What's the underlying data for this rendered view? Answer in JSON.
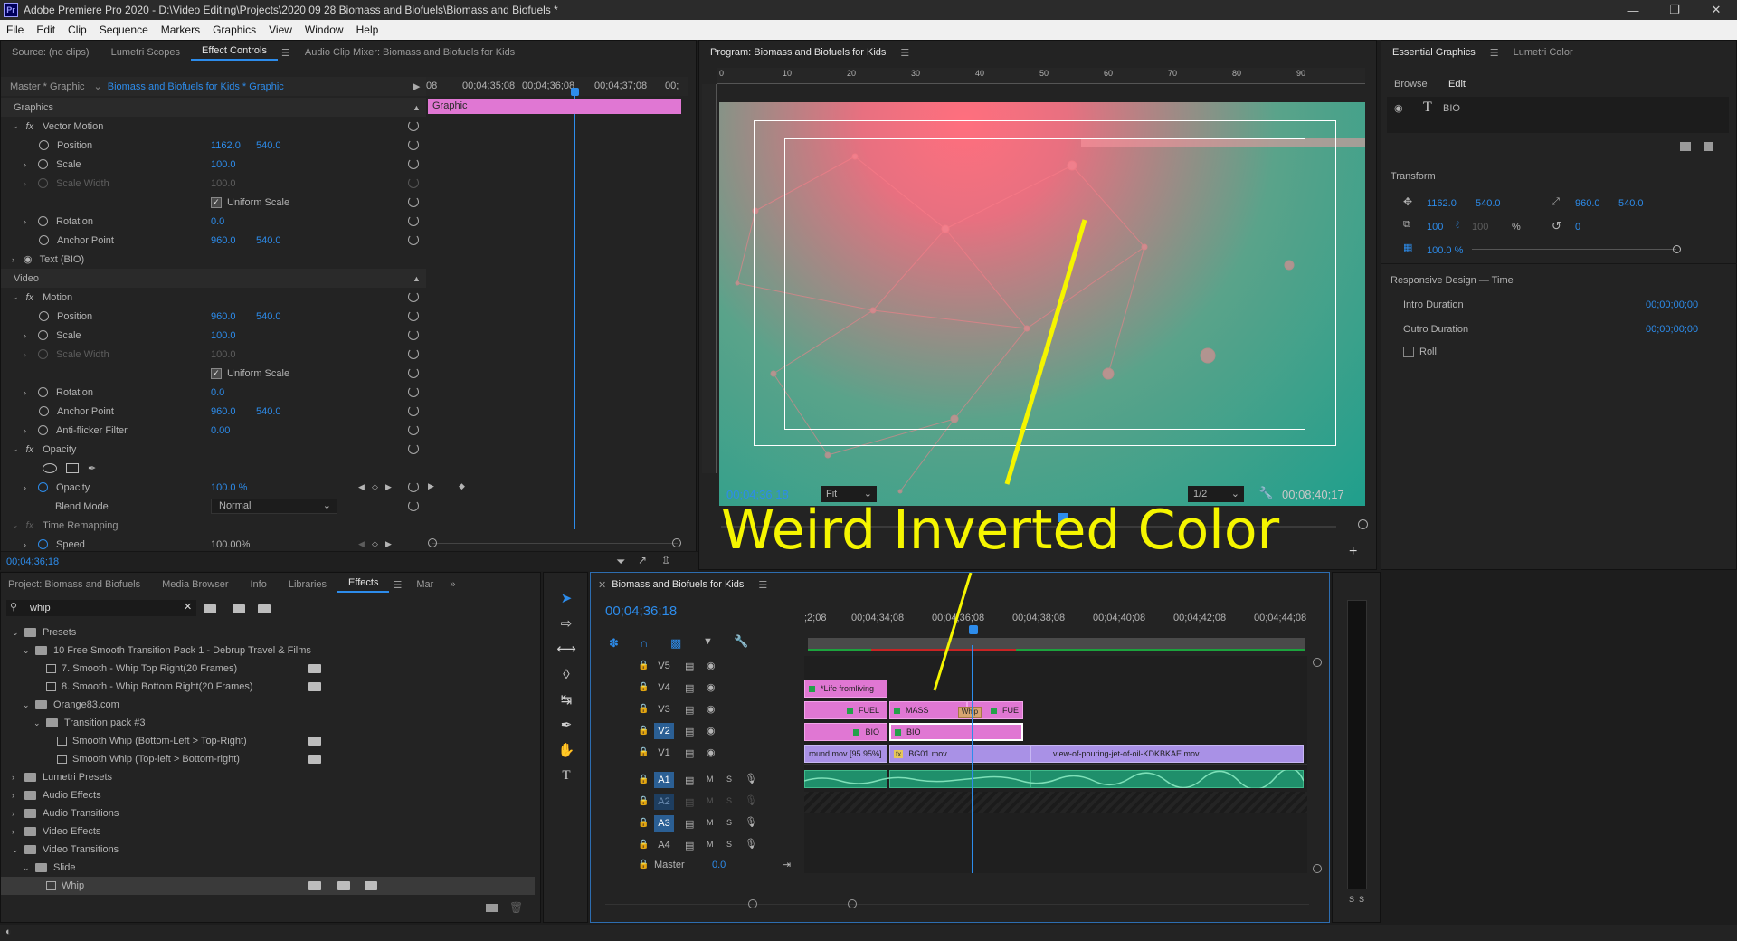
{
  "app": {
    "window_title": "Adobe Premiere Pro 2020 - D:\\Video Editing\\Projects\\2020 09 28 Biomass and Biofuels\\Biomass and Biofuels *",
    "logo": "Pr",
    "menu": [
      "File",
      "Edit",
      "Clip",
      "Sequence",
      "Markers",
      "Graphics",
      "View",
      "Window",
      "Help"
    ]
  },
  "effect_controls": {
    "tabs": [
      "Source: (no clips)",
      "Lumetri Scopes",
      "Effect Controls",
      "Audio Clip Mixer: Biomass and Biofuels for Kids"
    ],
    "active_tab": "Effect Controls",
    "master_label": "Master * Graphic",
    "sequence_label": "Biomass and Biofuels for Kids * Graphic",
    "ruler": [
      "00;04;35;08",
      "00;04;36;08",
      "00;04;37;08",
      "00;"
    ],
    "ruler_left": "08",
    "clip_bar": "Graphic",
    "graphics_header": "Graphics",
    "vector_motion": "Vector Motion",
    "vm_position": {
      "label": "Position",
      "x": "1162.0",
      "y": "540.0"
    },
    "vm_scale": {
      "label": "Scale",
      "value": "100.0"
    },
    "vm_scale_width": {
      "label": "Scale Width",
      "value": "100.0"
    },
    "uniform_scale": "Uniform Scale",
    "vm_rotation": {
      "label": "Rotation",
      "value": "0.0"
    },
    "vm_anchor": {
      "label": "Anchor Point",
      "x": "960.0",
      "y": "540.0"
    },
    "text_layer": "Text (BIO)",
    "video_header": "Video",
    "motion": "Motion",
    "m_position": {
      "label": "Position",
      "x": "960.0",
      "y": "540.0"
    },
    "m_scale": {
      "label": "Scale",
      "value": "100.0"
    },
    "m_scale_width": {
      "label": "Scale Width",
      "value": "100.0"
    },
    "m_rotation": {
      "label": "Rotation",
      "value": "0.0"
    },
    "m_anchor": {
      "label": "Anchor Point",
      "x": "960.0",
      "y": "540.0"
    },
    "anti_flicker": {
      "label": "Anti-flicker Filter",
      "value": "0.00"
    },
    "opacity_section": "Opacity",
    "opacity": {
      "label": "Opacity",
      "value": "100.0 %"
    },
    "blend_mode": {
      "label": "Blend Mode",
      "value": "Normal"
    },
    "time_remapping": "Time Remapping",
    "speed": {
      "label": "Speed",
      "value": "100.00%"
    },
    "timecode": "00;04;36;18"
  },
  "program": {
    "tab": "Program: Biomass and Biofuels for Kids",
    "ruler": [
      "0",
      "10",
      "20",
      "30",
      "40",
      "50",
      "60",
      "70",
      "80",
      "90"
    ],
    "timecode": "00;04;36;18",
    "fit": "Fit",
    "resolution": "1/2",
    "duration": "00;08;40;17",
    "annotation": "Weird Inverted Color",
    "annotation_color": "#f5f500"
  },
  "essential_graphics": {
    "tabs": [
      "Essential Graphics",
      "Lumetri Color"
    ],
    "subtabs": [
      "Browse",
      "Edit"
    ],
    "layer": "BIO",
    "transform_label": "Transform",
    "pos_x": "1162.0",
    "pos_y": "540.0",
    "anchor_x": "960.0",
    "anchor_y": "540.0",
    "scale": "100",
    "scale2": "100",
    "pct": "%",
    "rotation": "0",
    "opacity": "100.0 %",
    "responsive": "Responsive Design — Time",
    "intro_label": "Intro Duration",
    "intro_value": "00;00;00;00",
    "outro_label": "Outro Duration",
    "outro_value": "00;00;00;00",
    "roll": "Roll"
  },
  "project": {
    "tabs": [
      "Project: Biomass and Biofuels",
      "Media Browser",
      "Info",
      "Libraries",
      "Effects",
      "Mar"
    ],
    "active_tab": "Effects",
    "search": "whip",
    "tree": [
      {
        "indent": 0,
        "type": "folder",
        "label": "Presets"
      },
      {
        "indent": 1,
        "type": "folder",
        "label": "10 Free Smooth Transition Pack 1 - Debrup Travel & Films"
      },
      {
        "indent": 2,
        "type": "preset",
        "label": "7. Smooth - Whip Top Right(20 Frames)"
      },
      {
        "indent": 2,
        "type": "preset",
        "label": "8. Smooth - Whip Bottom Right(20 Frames)"
      },
      {
        "indent": 1,
        "type": "folder",
        "label": "Orange83.com"
      },
      {
        "indent": 2,
        "type": "folder",
        "label": "Transition pack #3"
      },
      {
        "indent": 3,
        "type": "preset",
        "label": "Smooth Whip (Bottom-Left > Top-Right)"
      },
      {
        "indent": 3,
        "type": "preset",
        "label": "Smooth Whip (Top-left > Bottom-right)"
      },
      {
        "indent": 0,
        "type": "folder",
        "label": "Lumetri Presets"
      },
      {
        "indent": 0,
        "type": "folder",
        "label": "Audio Effects"
      },
      {
        "indent": 0,
        "type": "folder",
        "label": "Audio Transitions"
      },
      {
        "indent": 0,
        "type": "folder",
        "label": "Video Effects"
      },
      {
        "indent": 0,
        "type": "folder",
        "label": "Video Transitions"
      },
      {
        "indent": 1,
        "type": "folder",
        "label": "Slide"
      },
      {
        "indent": 2,
        "type": "transition",
        "label": "Whip"
      }
    ]
  },
  "timeline": {
    "tab": "Biomass and Biofuels for Kids",
    "timecode": "00;04;36;18",
    "ruler": [
      ";2;08",
      "00;04;34;08",
      "00;04;36;08",
      "00;04;38;08",
      "00;04;40;08",
      "00;04;42;08",
      "00;04;44;08"
    ],
    "video_tracks": [
      "V5",
      "V4",
      "V3",
      "V2",
      "V1"
    ],
    "audio_tracks": [
      "A1",
      "A2",
      "A3",
      "A4"
    ],
    "master": "Master",
    "master_value": "0.0",
    "audio_buttons": [
      "M",
      "S"
    ],
    "clips": {
      "life": "*Life fromliving",
      "fuel": "FUEL",
      "mass": "MASS",
      "fue": "FUE",
      "whip": "Whip",
      "bio1": "BIO",
      "bio2": "BIO",
      "round": "round.mov [95.95%]",
      "bg01": "BG01.mov",
      "oil": "view-of-pouring-jet-of-oil-KDKBKAE.mov",
      "fx": "fx"
    }
  },
  "meter": {
    "labels": [
      "S",
      "S"
    ]
  }
}
